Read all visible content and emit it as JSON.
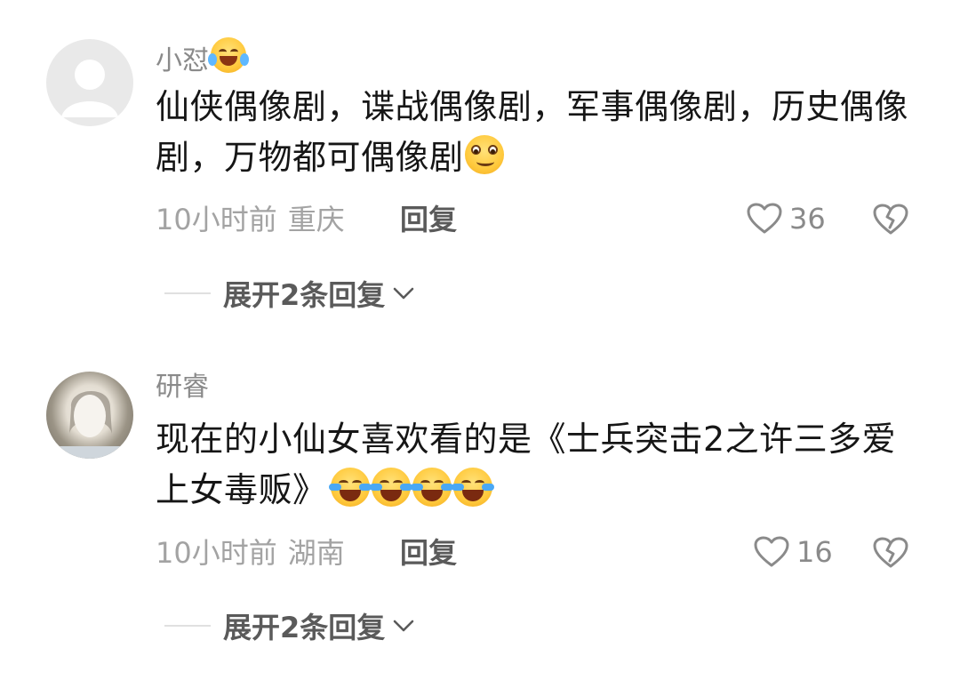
{
  "comments": [
    {
      "username": "小怼",
      "username_emoji": "laughing-tears-emoji",
      "text_part1": "仙侠偶像剧，谍战偶像剧，军事偶像剧，历史偶像剧，万物都可偶像剧",
      "trailing_emoji": "smirk-emoji",
      "time": "10小时前",
      "location": "重庆",
      "reply_label": "回复",
      "like_count": "36",
      "expand_label": "展开2条回复"
    },
    {
      "username": "研睿",
      "text_part1": "现在的小仙女喜欢看的是《士兵突击2之许三多爱上女毒贩》",
      "trailing_emoji": "crying-laughing-emoji",
      "trailing_emoji_count": 4,
      "time": "10小时前",
      "location": "湖南",
      "reply_label": "回复",
      "like_count": "16",
      "expand_label": "展开2条回复"
    }
  ],
  "colors": {
    "username": "#8a8a8a",
    "text": "#161616",
    "meta": "#a3a3a3",
    "action": "#5a5a5a"
  }
}
